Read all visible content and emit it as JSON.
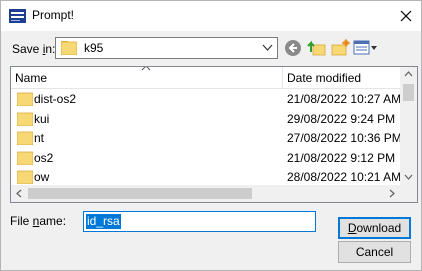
{
  "window": {
    "title": "Prompt!"
  },
  "toolbar": {
    "save_in_label_pre": "Save ",
    "save_in_label_u": "i",
    "save_in_label_post": "n:",
    "location": "k95"
  },
  "columns": {
    "name": "Name",
    "date_modified": "Date modified"
  },
  "files": [
    {
      "name": "dist-os2",
      "date": "21/08/2022 10:27 AM"
    },
    {
      "name": "kui",
      "date": "29/08/2022 9:24 PM"
    },
    {
      "name": "nt",
      "date": "27/08/2022 10:36 PM"
    },
    {
      "name": "os2",
      "date": "21/08/2022 9:12 PM"
    },
    {
      "name": "ow",
      "date": "28/08/2022 10:21 AM"
    }
  ],
  "footer": {
    "file_name_label_pre": "File ",
    "file_name_label_u": "n",
    "file_name_label_post": "ame:",
    "file_name_value": "id_rsa",
    "download_pre": "",
    "download_u": "D",
    "download_post": "ownload",
    "cancel_label": "Cancel"
  },
  "colors": {
    "accent": "#0078d7",
    "folder": "#f8d775"
  }
}
